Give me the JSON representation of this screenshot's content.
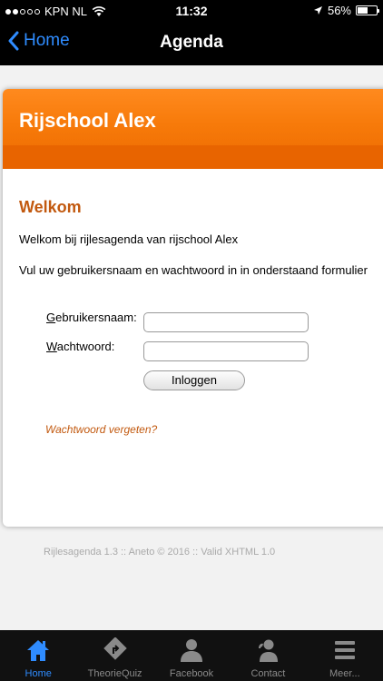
{
  "status_bar": {
    "carrier": "KPN NL",
    "time": "11:32",
    "battery": "56%",
    "battery_level": 0.56
  },
  "nav": {
    "back_label": "Home",
    "title": "Agenda"
  },
  "page": {
    "header_title": "Rijschool Alex",
    "welcome_heading": "Welkom",
    "intro_line": "Welkom bij rijlesagenda van rijschool Alex",
    "instruction_line": "Vul uw gebruikersnaam en wachtwoord in in onderstaand formulier",
    "username_label_first": "G",
    "username_label_rest": "ebruikersnaam:",
    "password_label_first": "W",
    "password_label_rest": "achtwoord:",
    "username_value": "",
    "password_value": "",
    "login_button": "Inloggen",
    "forgot_link": "Wachtwoord vergeten?",
    "footer": "Rijlesagenda 1.3 :: Aneto © 2016 :: Valid XHTML 1.0"
  },
  "tabs": [
    {
      "label": "Home",
      "icon": "home-icon",
      "active": true
    },
    {
      "label": "TheorieQuiz",
      "icon": "road-sign-icon",
      "active": false
    },
    {
      "label": "Facebook",
      "icon": "person-icon",
      "active": false
    },
    {
      "label": "Contact",
      "icon": "contact-icon",
      "active": false
    },
    {
      "label": "Meer...",
      "icon": "menu-icon",
      "active": false
    }
  ],
  "colors": {
    "accent_blue": "#2f8cff",
    "header_orange": "#f77a0a",
    "heading_brown": "#c2590f"
  }
}
